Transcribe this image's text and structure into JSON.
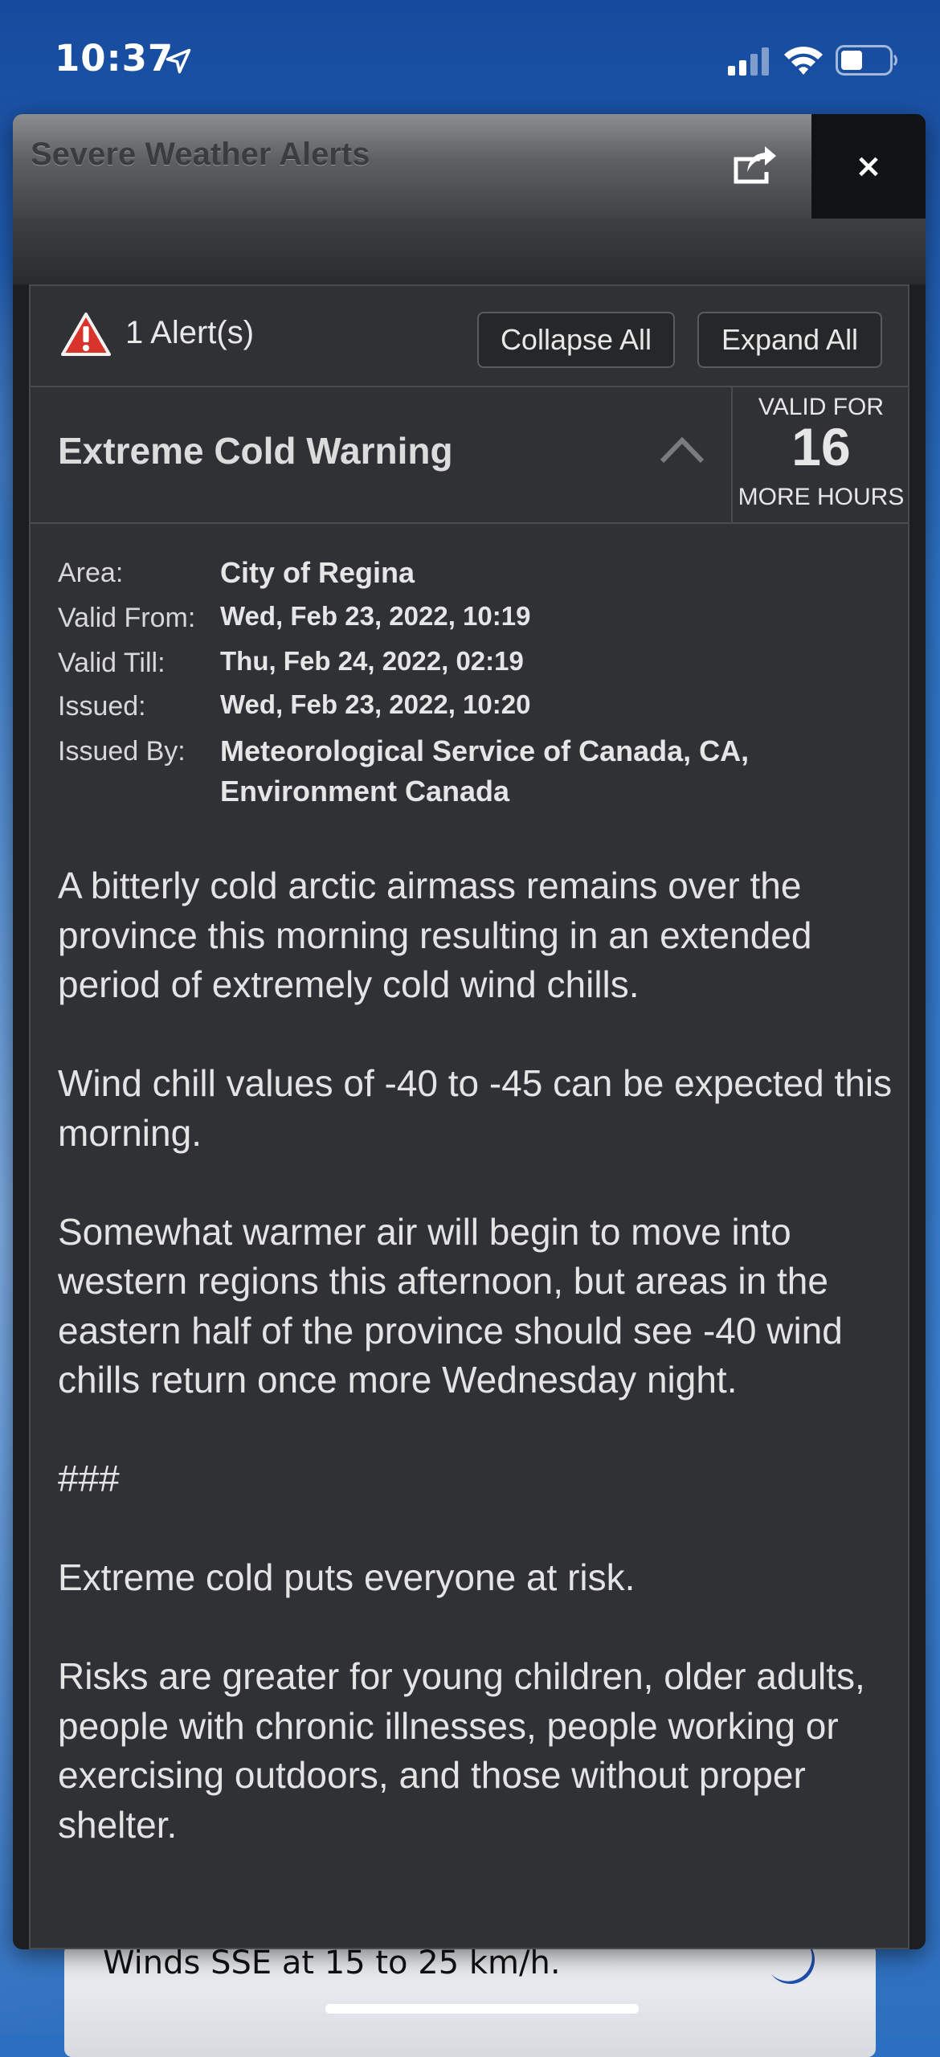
{
  "status_bar": {
    "time": "10:37"
  },
  "dialog": {
    "title": "Severe Weather Alerts",
    "close_label": "×",
    "alerts_count_label": "1 Alert(s)",
    "collapse_all_label": "Collapse All",
    "expand_all_label": "Expand All",
    "alert": {
      "title": "Extreme Cold Warning",
      "valid_for_label": "VALID FOR",
      "valid_hours": "16",
      "more_hours_label": "MORE HOURS",
      "details": [
        {
          "label": "Area:",
          "value": "City of Regina"
        },
        {
          "label": "Valid From:",
          "value": "Wed, Feb 23, 2022,   10:19"
        },
        {
          "label": "Valid Till:",
          "value": "Thu, Feb 24, 2022,   02:19"
        },
        {
          "label": "Issued:",
          "value": "Wed, Feb 23, 2022,   10:20"
        },
        {
          "label": "Issued By:",
          "value_line1": "Meteorological Service of Canada, CA,",
          "value_line2": "Environment Canada"
        }
      ],
      "paragraphs": [
        "A bitterly cold arctic airmass remains over the province this morning resulting in an extended period of extremely cold wind chills.",
        "Wind chill values of -40 to -45 can be expected this morning.",
        "Somewhat warmer air will begin to move into western regions this afternoon,  but areas in the eastern half of the province should see -40 wind chills return once more Wednesday night.",
        "###",
        "Extreme cold puts everyone at risk.",
        "Risks are greater for young children, older adults, people with chronic illnesses, people working or exercising outdoors, and those without proper shelter."
      ]
    }
  },
  "background": {
    "card_text": "Winds SSE at 15 to 25 km/h."
  }
}
